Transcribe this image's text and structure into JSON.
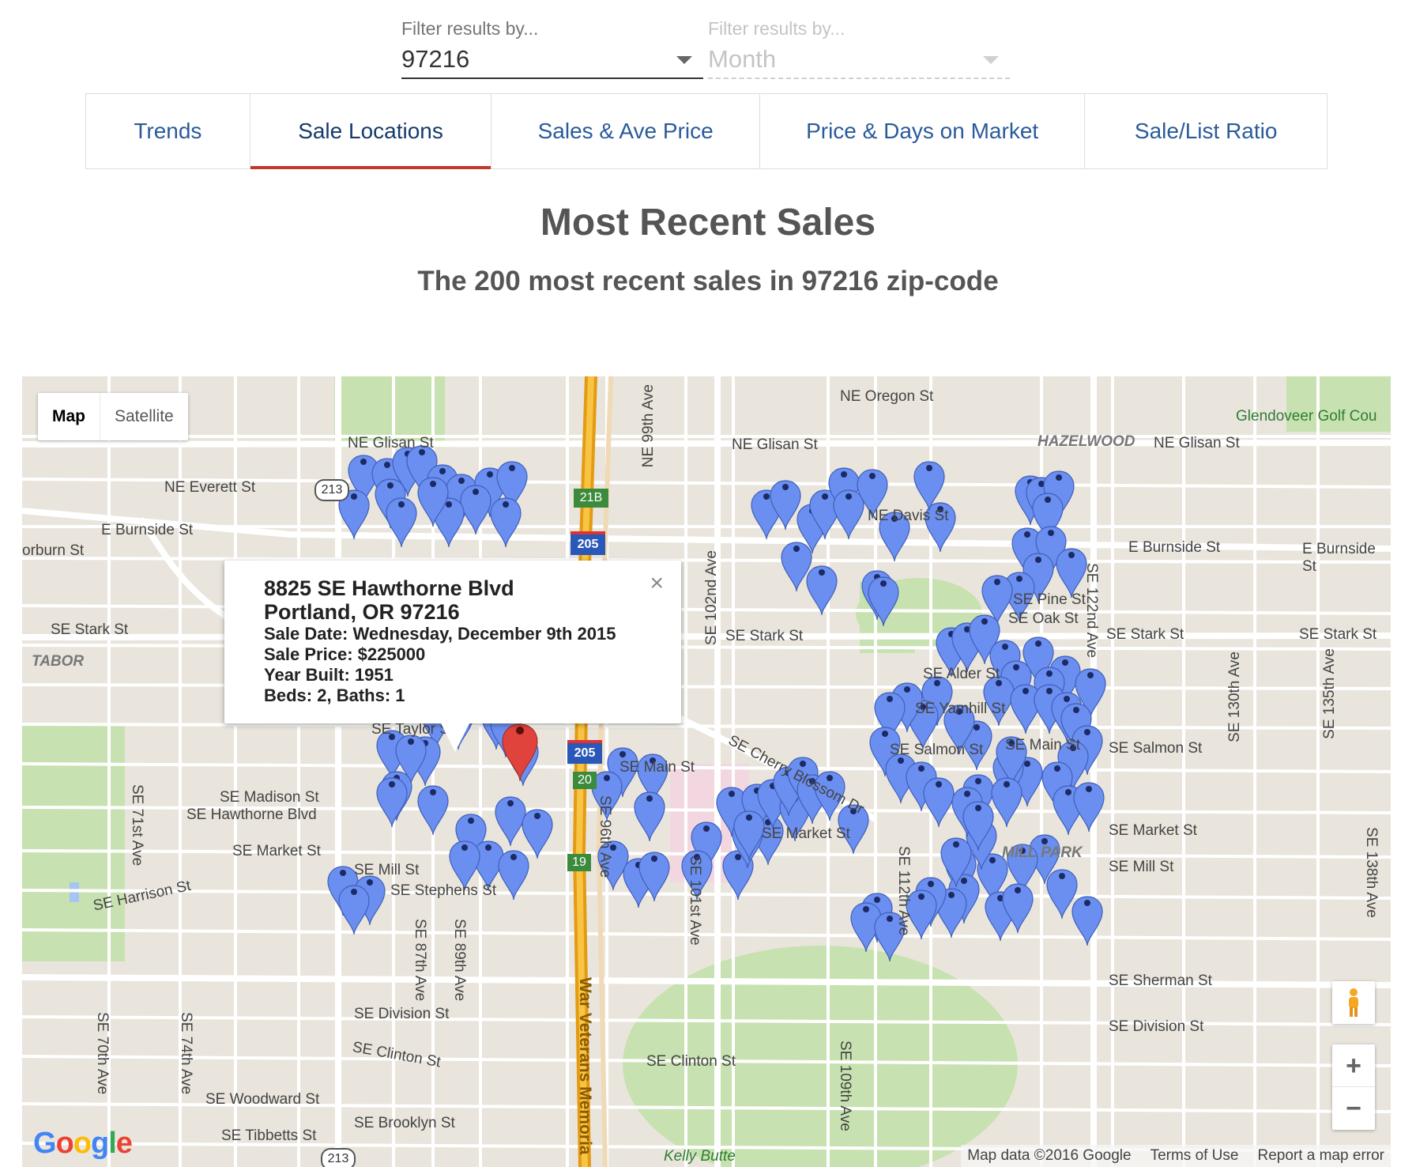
{
  "filters": [
    {
      "label": "Filter results by...",
      "value": "97216",
      "disabled": false
    },
    {
      "label": "Filter results by...",
      "value": "Month",
      "disabled": true
    }
  ],
  "tabs": [
    {
      "label": "Trends",
      "active": false
    },
    {
      "label": "Sale Locations",
      "active": true
    },
    {
      "label": "Sales & Ave Price",
      "active": false
    },
    {
      "label": "Price & Days on Market",
      "active": false
    },
    {
      "label": "Sale/List Ratio",
      "active": false
    }
  ],
  "heading": "Most Recent Sales",
  "subheading": "The 200 most recent sales in 97216 zip-code",
  "map": {
    "map_type": {
      "map": "Map",
      "satellite": "Satellite",
      "selected": "Map"
    },
    "street_labels": [
      "NE Oregon St",
      "NE Glisan St",
      "NE Glisan St",
      "HAZELWOOD",
      "NE Glisan St",
      "Glendoveer Golf Cou",
      "NE Everett St",
      "E Burnside St",
      "orburn St",
      "E Burnside St",
      "E Burnside St",
      "NE Davis St",
      "SE Stark St",
      "TABOR",
      "SE Stark St",
      "SE Stark St",
      "SE Stark St",
      "SE Pine St",
      "SE Oak St",
      "SE Cherry Blossom Dr",
      "SE Main St",
      "SE Salmon St",
      "SE Market St",
      "SE Mill St",
      "MILL PARK",
      "SE Madison St",
      "SE Hawthorne Blvd",
      "SE Market St",
      "SE Mill St",
      "SE Stephens St",
      "SE Harrison St",
      "SE Division St",
      "SE Division St",
      "SE Sherman St",
      "SE Clinton St",
      "SE Clinton St",
      "SE Woodward St",
      "SE Tibbetts St",
      "SE Brooklyn St",
      "Kelly Butte",
      "NE 99th Ave",
      "SE 102nd Ave",
      "SE 122nd Ave",
      "SE 130th Ave",
      "SE 135th Ave",
      "SE 138th Ave",
      "SE 112th Ave",
      "SE 96th Ave",
      "SE 101st Ave",
      "SE 109th Ave",
      "SE 87th Ave",
      "SE 89th Ave",
      "SE 71st Ave",
      "SE 70th Ave",
      "SE 74th Ave",
      "War Veterans Memoria",
      "SE Yamhill St",
      "SE Alder St",
      "SE Salmon St",
      "SE Main St",
      "SE Market St",
      "SE Taylor St"
    ],
    "shields": [
      "213",
      "21B",
      "205",
      "205",
      "20",
      "19",
      "213"
    ],
    "info_window": {
      "address_line1": "8825 SE Hawthorne Blvd",
      "address_line2": "Portland, OR 97216",
      "sale_date": "Sale Date: Wednesday, December 9th 2015",
      "sale_price": "Sale Price: $225000",
      "year_built": "Year Built: 1951",
      "beds_baths": "Beds: 2, Baths: 1",
      "close": "×"
    },
    "zoom_in": "+",
    "zoom_out": "−",
    "attribution": {
      "data": "Map data ©2016 Google",
      "terms": "Terms of Use",
      "report": "Report a map error"
    },
    "logo": "Google",
    "colors": {
      "marker": "#6b8ff0",
      "selected_marker": "#e0433b",
      "highway": "#f6a81c",
      "park": "#c7e2b0"
    }
  }
}
